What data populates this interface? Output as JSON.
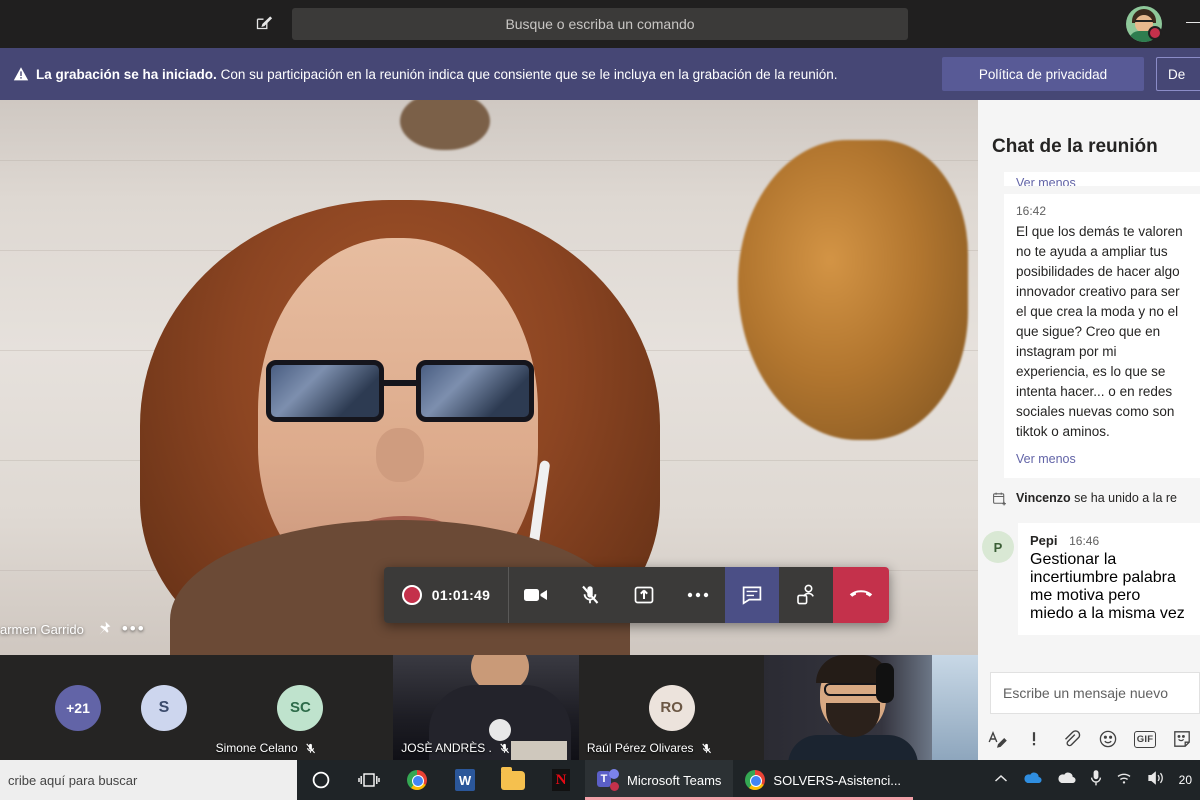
{
  "titlebar": {
    "compose_icon": "compose-pencil-icon",
    "search_placeholder": "Busque o escriba un comando",
    "avatar_icon": "user-avatar",
    "presence": "busy",
    "minimize_label": "—"
  },
  "banner": {
    "warning_icon": "warning-triangle-icon",
    "bold_text": "La grabación se ha iniciado.",
    "text": " Con su participación en la reunión indica que consiente que se le incluya en la grabación de la reunión.",
    "privacy_button": "Política de privacidad",
    "dismiss_button": "De"
  },
  "stage": {
    "speaker_name": "armen Garrido",
    "pin_icon": "pin-icon",
    "more_icon": "more-options-icon"
  },
  "callbar": {
    "record_icon": "record-dot-icon",
    "timer": "01:01:49",
    "camera_icon": "camera-icon",
    "mic_icon": "mic-muted-icon",
    "share_icon": "share-screen-icon",
    "more_icon": "more-options-icon",
    "chat_icon": "chat-icon",
    "people_icon": "people-icon",
    "hangup_icon": "hangup-icon"
  },
  "filmstrip": {
    "overflow_count": "+21",
    "overflow_initial": "S",
    "tiles": [
      {
        "initials": "SC",
        "name": "Simone Celano",
        "muted": true
      },
      {
        "initials": "",
        "name": "JOSÈ ANDRÈS .",
        "muted": true
      },
      {
        "initials": "RO",
        "name": "Raúl Pérez Olivares",
        "muted": true
      },
      {
        "initials": "",
        "name": "",
        "muted": false
      }
    ]
  },
  "chat": {
    "title": "Chat de la reunión",
    "cut_link": "Ver menos",
    "messages": [
      {
        "time": "16:42",
        "body": "El que los demás te valoren no te ayuda a ampliar tus posibilidades de hacer algo innovador creativo para ser el que crea la moda y no el que sigue? Creo que en instagram por mi experiencia, es lo que se intenta hacer... o en redes sociales nuevas como son tiktok o aminos.",
        "more_link": "Ver menos"
      }
    ],
    "system_message": {
      "icon": "calendar-add-icon",
      "who": "Vincenzo",
      "text": " se ha unido a la re"
    },
    "reply": {
      "avatar_initial": "P",
      "who": "Pepi",
      "time": "16:46",
      "body": "Gestionar la incertiumbre palabra me motiva pero miedo a la misma vez"
    },
    "composer": {
      "placeholder": "Escribe un mensaje nuevo",
      "tools": [
        {
          "icon": "format-text-icon",
          "label": "A"
        },
        {
          "icon": "important-icon",
          "label": "!"
        },
        {
          "icon": "attach-icon",
          "label": ""
        },
        {
          "icon": "emoji-icon",
          "label": ""
        },
        {
          "icon": "gif-icon",
          "label": "GIF"
        },
        {
          "icon": "sticker-icon",
          "label": ""
        }
      ]
    }
  },
  "taskbar": {
    "search_placeholder": "cribe aquí para buscar",
    "cortana_icon": "cortana-circle-icon",
    "taskview_icon": "task-view-icon",
    "pinned": [
      {
        "icon": "chrome-icon",
        "label": "Google Chrome"
      },
      {
        "icon": "word-icon",
        "label": "W"
      },
      {
        "icon": "file-explorer-icon",
        "label": "File Explorer"
      },
      {
        "icon": "netflix-icon",
        "label": "N"
      }
    ],
    "windows": [
      {
        "icon": "teams-icon",
        "label": "Microsoft Teams",
        "active": true
      },
      {
        "icon": "chrome-icon",
        "label": "SOLVERS-Asistenci...",
        "active": false
      }
    ],
    "tray": [
      {
        "icon": "show-hidden-icons-icon"
      },
      {
        "icon": "onedrive-blue-icon"
      },
      {
        "icon": "onedrive-white-icon"
      },
      {
        "icon": "microphone-icon"
      },
      {
        "icon": "wifi-icon"
      },
      {
        "icon": "volume-icon"
      }
    ],
    "clock": "20"
  }
}
